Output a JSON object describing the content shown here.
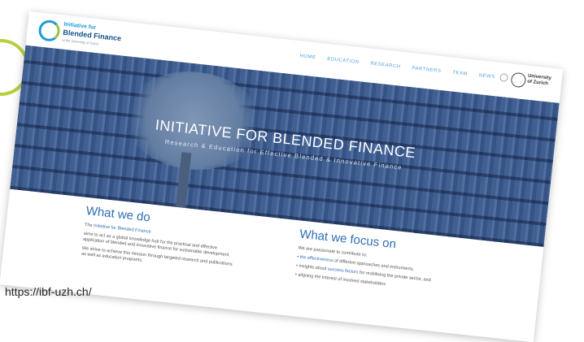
{
  "logo": {
    "line1": "Initiative for",
    "line2": "Blended Finance",
    "line3": "at the University of Zurich"
  },
  "nav": {
    "items": [
      "HOME",
      "EDUCATION",
      "RESEARCH",
      "PARTNERS",
      "TEAM",
      "NEWS"
    ]
  },
  "university": "University of Zurich",
  "hero": {
    "title": "INITIATIVE FOR BLENDED FINANCE",
    "subtitle": "Research & Education for Effective Blended & Innovative Finance"
  },
  "what_we_do": {
    "heading": "What we do",
    "lead_prefix": "The",
    "lead_link": "Initiative for Blended Finance",
    "p1": "aims to act as a global knowledge hub for the practical and effective application of blended and innovative finance for sustainable development.",
    "p2": "We strive to achieve this mission through targeted research and publications as well as education programs."
  },
  "what_we_focus_on": {
    "heading": "What we focus on",
    "intro": "We are passionate to contribute to:",
    "bullet1_link": "the effectiveness",
    "bullet1_rest": "of different approaches and instruments,",
    "bullet2_pre": "insights about",
    "bullet2_link": "success factors",
    "bullet2_rest": "for mobilising the private sector, and",
    "bullet3": "aligning the interest of involved stakeholders"
  },
  "caption": "https://ibf-uzh.ch/",
  "colors": {
    "accent": "#2f6fb4",
    "lime": "#b9cf3c"
  }
}
